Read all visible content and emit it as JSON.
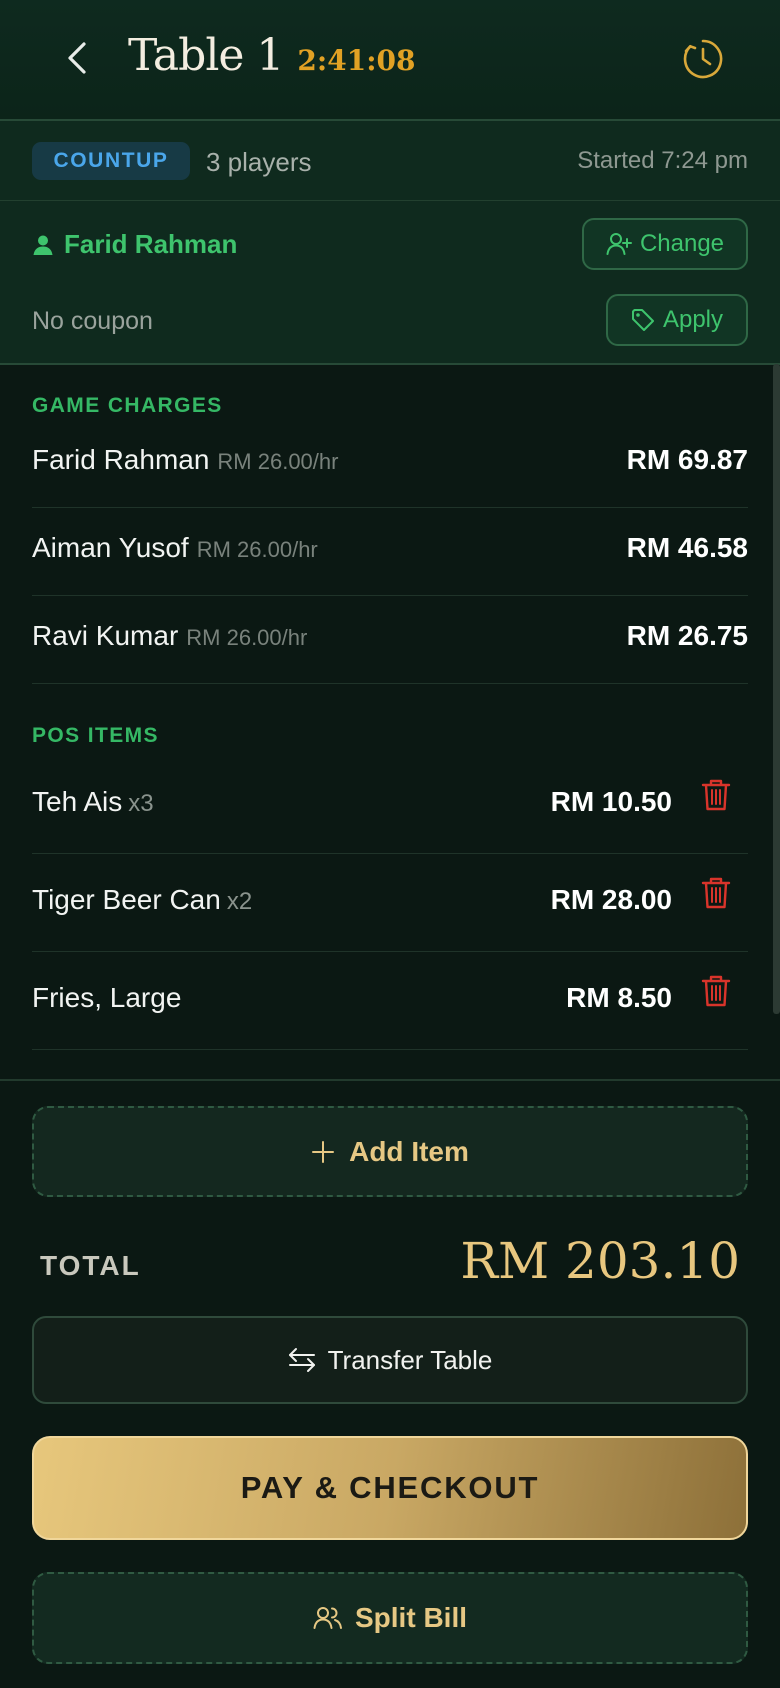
{
  "header": {
    "title": "Table 1",
    "timer": "2:41:08",
    "back_icon": "chevron-left-icon",
    "history_icon": "clock-icon"
  },
  "session": {
    "mode_badge": "COUNTUP",
    "players": "3 players",
    "started": "Started 7:24 pm"
  },
  "customer": {
    "name": "Farid Rahman",
    "change_label": "Change",
    "coupon_text": "No coupon",
    "apply_label": "Apply"
  },
  "game_charges": {
    "label": "GAME CHARGES",
    "rows": [
      {
        "name": "Farid Rahman",
        "rate": "RM 26.00/hr",
        "amount": "RM 69.87"
      },
      {
        "name": "Aiman Yusof",
        "rate": "RM 26.00/hr",
        "amount": "RM 46.58"
      },
      {
        "name": "Ravi Kumar",
        "rate": "RM 26.00/hr",
        "amount": "RM 26.75"
      }
    ]
  },
  "pos_items": {
    "label": "POS ITEMS",
    "rows": [
      {
        "name": "Teh Ais",
        "qty": "x3",
        "amount": "RM 10.50"
      },
      {
        "name": "Tiger Beer Can",
        "qty": "x2",
        "amount": "RM 28.00"
      },
      {
        "name": "Fries, Large",
        "qty": "",
        "amount": "RM 8.50"
      }
    ]
  },
  "footer": {
    "add_item_label": "Add Item",
    "total_label": "TOTAL",
    "total_value": "RM 203.10",
    "transfer_label": "Transfer Table",
    "pay_label": "PAY & CHECKOUT",
    "split_label": "Split Bill"
  },
  "colors": {
    "accent_green": "#3ec46d",
    "accent_gold": "#e8c77f",
    "timer_orange": "#e1a124",
    "badge_blue": "#4aa6ea",
    "delete_red": "#d9342b"
  }
}
